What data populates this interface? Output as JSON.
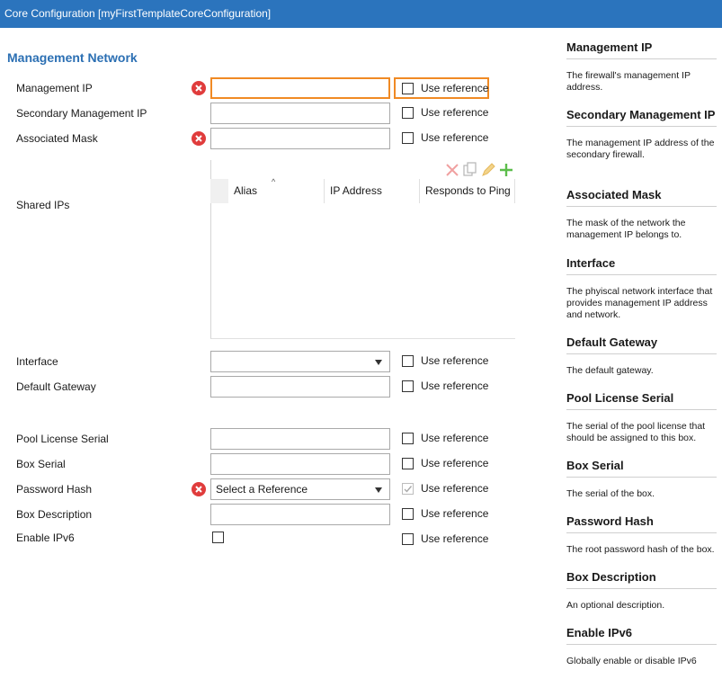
{
  "window": {
    "title": "Core Configuration [myFirstTemplateCoreConfiguration]"
  },
  "section": {
    "title": "Management Network"
  },
  "form": {
    "use_reference_label": "Use reference",
    "fields": {
      "management_ip": {
        "label": "Management IP",
        "value": ""
      },
      "secondary_management_ip": {
        "label": "Secondary Management IP",
        "value": ""
      },
      "associated_mask": {
        "label": "Associated Mask",
        "value": ""
      },
      "shared_ips": {
        "label": "Shared IPs"
      },
      "interface": {
        "label": "Interface",
        "value": ""
      },
      "default_gateway": {
        "label": "Default Gateway",
        "value": ""
      },
      "pool_license_serial": {
        "label": "Pool License Serial",
        "value": ""
      },
      "box_serial": {
        "label": "Box Serial",
        "value": ""
      },
      "password_hash": {
        "label": "Password Hash",
        "value": "Select a Reference"
      },
      "box_description": {
        "label": "Box Description",
        "value": ""
      },
      "enable_ipv6": {
        "label": "Enable IPv6"
      }
    }
  },
  "shared_ips_grid": {
    "columns": [
      "Alias",
      "IP Address",
      "Responds to Ping"
    ],
    "tools": [
      "delete-icon",
      "copy-icon",
      "edit-icon",
      "add-icon"
    ]
  },
  "help": {
    "items": [
      {
        "title": "Management IP",
        "desc": "The firewall's management IP address."
      },
      {
        "title": "Secondary Management IP",
        "desc": "The management IP address of the secondary firewall."
      },
      {
        "title": "Associated Mask",
        "desc": "The mask of the network the management IP belongs to."
      },
      {
        "title": "Interface",
        "desc": "The phyiscal network interface that provides management IP address and network."
      },
      {
        "title": "Default Gateway",
        "desc": "The default gateway."
      },
      {
        "title": "Pool License Serial",
        "desc": "The serial of the pool license that should be assigned to this box."
      },
      {
        "title": "Box Serial",
        "desc": "The serial of the box."
      },
      {
        "title": "Password Hash",
        "desc": "The root password hash of the box."
      },
      {
        "title": "Box Description",
        "desc": "An optional description."
      },
      {
        "title": "Enable IPv6",
        "desc": "Globally enable or disable IPv6"
      }
    ]
  },
  "colors": {
    "titlebar": "#2b74bd",
    "section_title": "#2b6fb3",
    "highlight": "#f08a24",
    "error": "#e03c3c"
  }
}
